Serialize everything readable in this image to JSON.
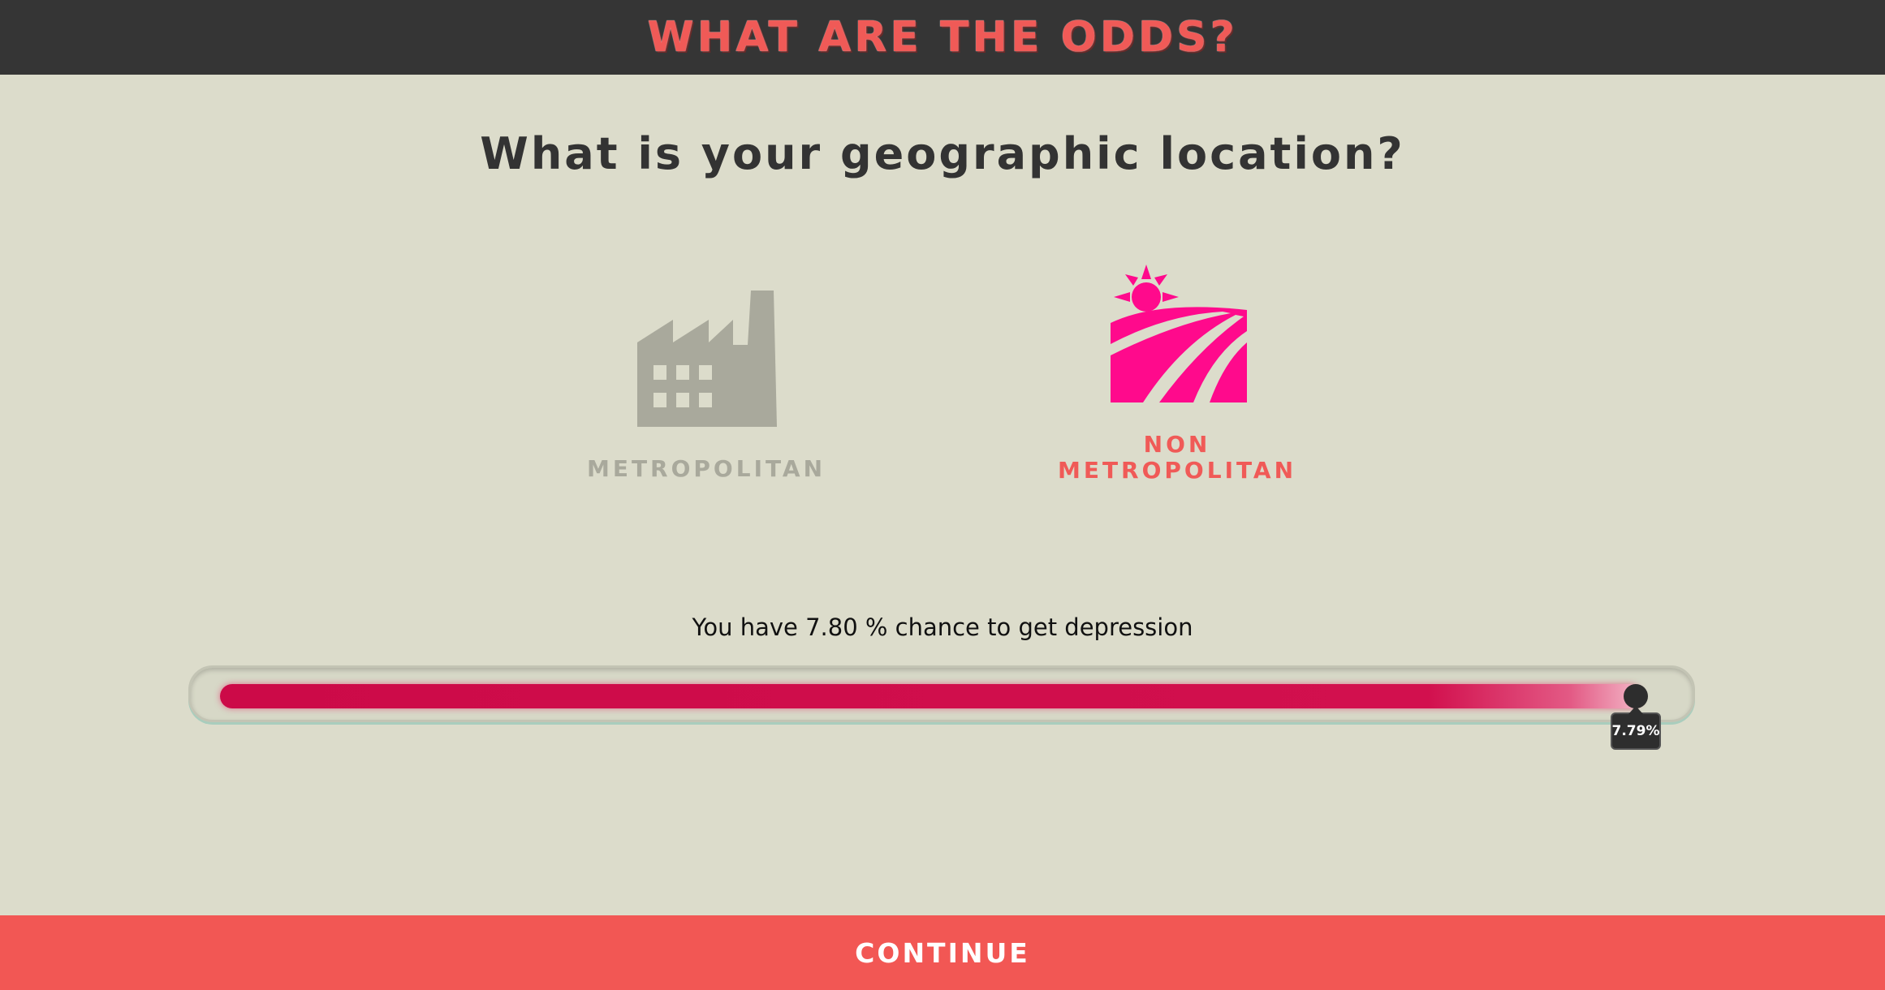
{
  "header": {
    "title": "WHAT ARE THE ODDS?"
  },
  "question": "What is your geographic location?",
  "options": [
    {
      "label": "METROPOLITAN",
      "icon": "factory-icon",
      "selected": false,
      "color": "#a9a99c"
    },
    {
      "label_line1": "NON",
      "label_line2": "METROPOLITAN",
      "icon": "farm-field-sun-icon",
      "selected": true,
      "color": "#f05a57"
    }
  ],
  "result": {
    "text": "You have 7.80 % chance to get depression"
  },
  "progress": {
    "value_percent": 97.7,
    "tooltip": "7.79%",
    "fill_color": "#cc0a48"
  },
  "footer": {
    "continue_label": "CONTINUE"
  },
  "colors": {
    "header_bg": "#353535",
    "accent": "#f05a57",
    "icon_pink": "#ff0a8c",
    "background": "#dcdccb"
  }
}
